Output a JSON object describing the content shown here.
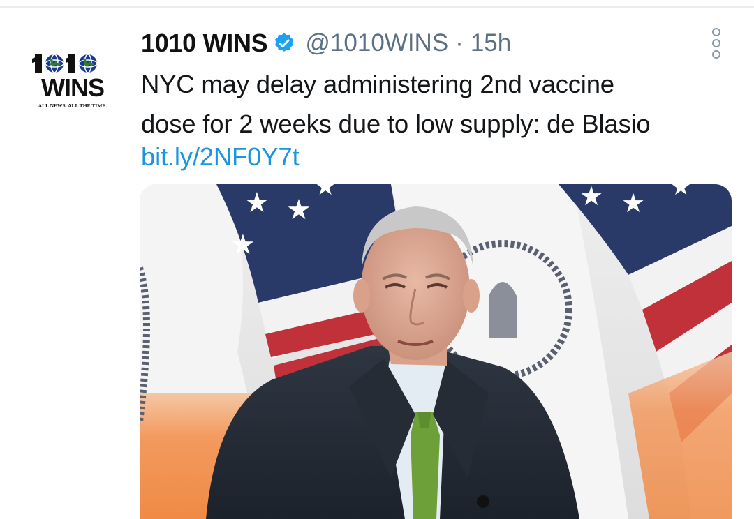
{
  "account": {
    "display_name": "1010 WINS",
    "handle": "@1010WINS",
    "separator": "·",
    "time": "15h",
    "avatar_logo": {
      "line1": "1010",
      "line2": "WINS",
      "tagline": "ALL NEWS. ALL THE TIME."
    }
  },
  "tweet": {
    "text_lines": [
      "NYC may delay administering 2nd vaccine",
      "dose for 2 weeks due to low supply: de Blasio"
    ],
    "link": "bit.ly/2NF0Y7t"
  },
  "icons": {
    "verified": "verified-badge-icon",
    "more": "more-options-icon"
  },
  "colors": {
    "verified_blue": "#1da1f2",
    "link_blue": "#1b95e0",
    "handle_gray": "#5b7083",
    "text_dark": "#14171a"
  }
}
